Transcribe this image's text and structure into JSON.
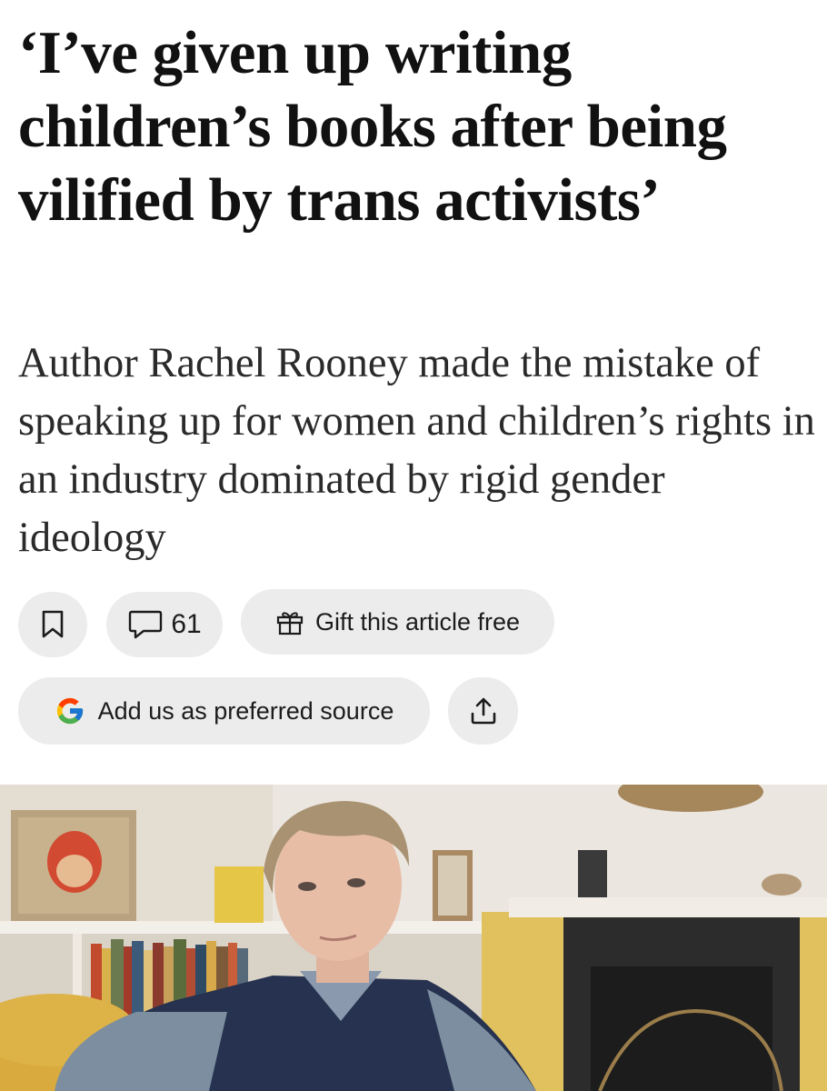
{
  "article": {
    "headline": "‘I’ve given up writing children’s books after being vilified by trans activists’",
    "standfirst": "Author Rachel Rooney made the mistake of speaking up for women and children’s rights in an industry dominated by rigid gender ideology"
  },
  "actions": {
    "bookmark_icon": "bookmark-icon",
    "comment_icon": "speech-bubble-icon",
    "comment_count": "61",
    "gift_icon": "gift-icon",
    "gift_label": "Gift this article free",
    "google_icon": "google-g-icon",
    "preferred_source_label": "Add us as preferred source",
    "share_icon": "share-upload-icon"
  },
  "image": {
    "subject": "portrait-photo"
  },
  "colors": {
    "pill_background": "#ececec",
    "headline_text": "#111111",
    "body_text": "#2a2a2a"
  }
}
